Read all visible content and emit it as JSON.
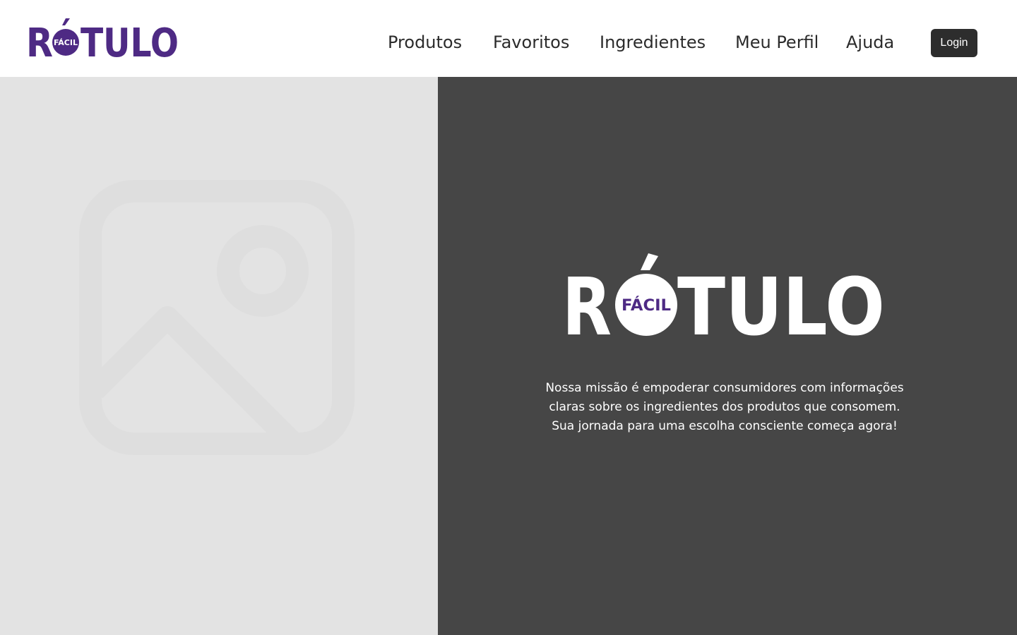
{
  "brand": {
    "name_main": "RÓTULO",
    "name_badge": "FÁCIL",
    "color_primary": "#4e2a84",
    "color_dark": "#2d2d2d"
  },
  "nav": {
    "items": [
      {
        "label": "Produtos"
      },
      {
        "label": "Favoritos"
      },
      {
        "label": "Ingredientes"
      },
      {
        "label": "Meu Perfil"
      },
      {
        "label": "Ajuda"
      }
    ],
    "login_label": "Login"
  },
  "hero": {
    "image_icon": "image-placeholder-icon",
    "mission_lines": [
      "Nossa missão é empoderar consumidores com informações",
      "claras sobre os ingredientes dos produtos que consomem.",
      "Sua jornada para uma escolha consciente começa agora!"
    ]
  }
}
